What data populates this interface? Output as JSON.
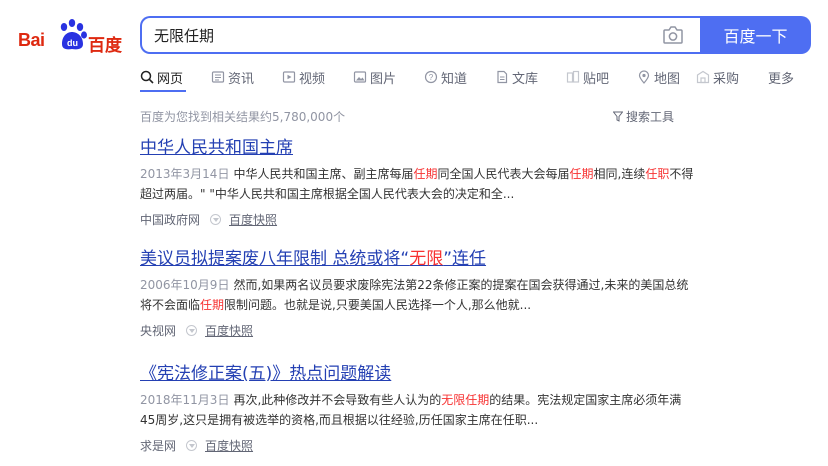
{
  "logo": {
    "text_latin": "Bai",
    "text_du": "du",
    "text_cn": "百度"
  },
  "search": {
    "query": "无限任期",
    "button_label": "百度一下"
  },
  "tabs": [
    {
      "label": "网页",
      "icon": "search-icon"
    },
    {
      "label": "资讯",
      "icon": "news-icon"
    },
    {
      "label": "视频",
      "icon": "video-icon"
    },
    {
      "label": "图片",
      "icon": "image-icon"
    },
    {
      "label": "知道",
      "icon": "question-icon"
    },
    {
      "label": "文库",
      "icon": "document-icon"
    },
    {
      "label": "贴吧",
      "icon": "forum-icon"
    },
    {
      "label": "地图",
      "icon": "map-pin-icon"
    },
    {
      "label": "采购",
      "icon": "shopping-icon"
    },
    {
      "label": "更多",
      "icon": ""
    }
  ],
  "result_count_text": "百度为您找到相关结果约5,780,000个",
  "tools_label": "搜索工具",
  "colors": {
    "brand_blue": "#4e6ef2",
    "highlight_red": "#f73131",
    "link_blue": "#2440b3"
  },
  "results": [
    {
      "title": [
        {
          "t": "中华人民共和国主席",
          "hl": false
        }
      ],
      "date": "2013年3月14日",
      "abstract": [
        {
          "t": "中华人民共和国主席、副主席每届",
          "hl": false
        },
        {
          "t": "任期",
          "hl": true
        },
        {
          "t": "同全国人民代表大会每届",
          "hl": false
        },
        {
          "t": "任期",
          "hl": true
        },
        {
          "t": "相同,连续",
          "hl": false
        },
        {
          "t": "任职",
          "hl": true
        },
        {
          "t": "不得超过两届。\" \"中华人民共和国主席根据全国人民代表大会的决定和全...",
          "hl": false
        }
      ],
      "source": "中国政府网",
      "snapshot": "百度快照"
    },
    {
      "title": [
        {
          "t": "美议员拟提案废八年限制 总统或将“",
          "hl": false
        },
        {
          "t": "无限",
          "hl": true
        },
        {
          "t": "”连任",
          "hl": false
        }
      ],
      "date": "2006年10月9日",
      "abstract": [
        {
          "t": "然而,如果两名议员要求废除宪法第22条修正案的提案在国会获得通过,未来的美国总统将不会面临",
          "hl": false
        },
        {
          "t": "任期",
          "hl": true
        },
        {
          "t": "限制问题。也就是说,只要美国人民选择一个人,那么他就...",
          "hl": false
        }
      ],
      "source": "央视网",
      "snapshot": "百度快照"
    },
    {
      "title": [
        {
          "t": "《宪法修正案(五)》热点问题解读",
          "hl": false
        }
      ],
      "date": "2018年11月3日",
      "abstract": [
        {
          "t": "再次,此种修改并不会导致有些人认为的",
          "hl": false
        },
        {
          "t": "无限任期",
          "hl": true
        },
        {
          "t": "的结果。宪法规定国家主席必须年满45周岁,这只是拥有被选举的资格,而且根据以往经验,历任国家主席在任职...",
          "hl": false
        }
      ],
      "source": "求是网",
      "snapshot": "百度快照"
    }
  ]
}
